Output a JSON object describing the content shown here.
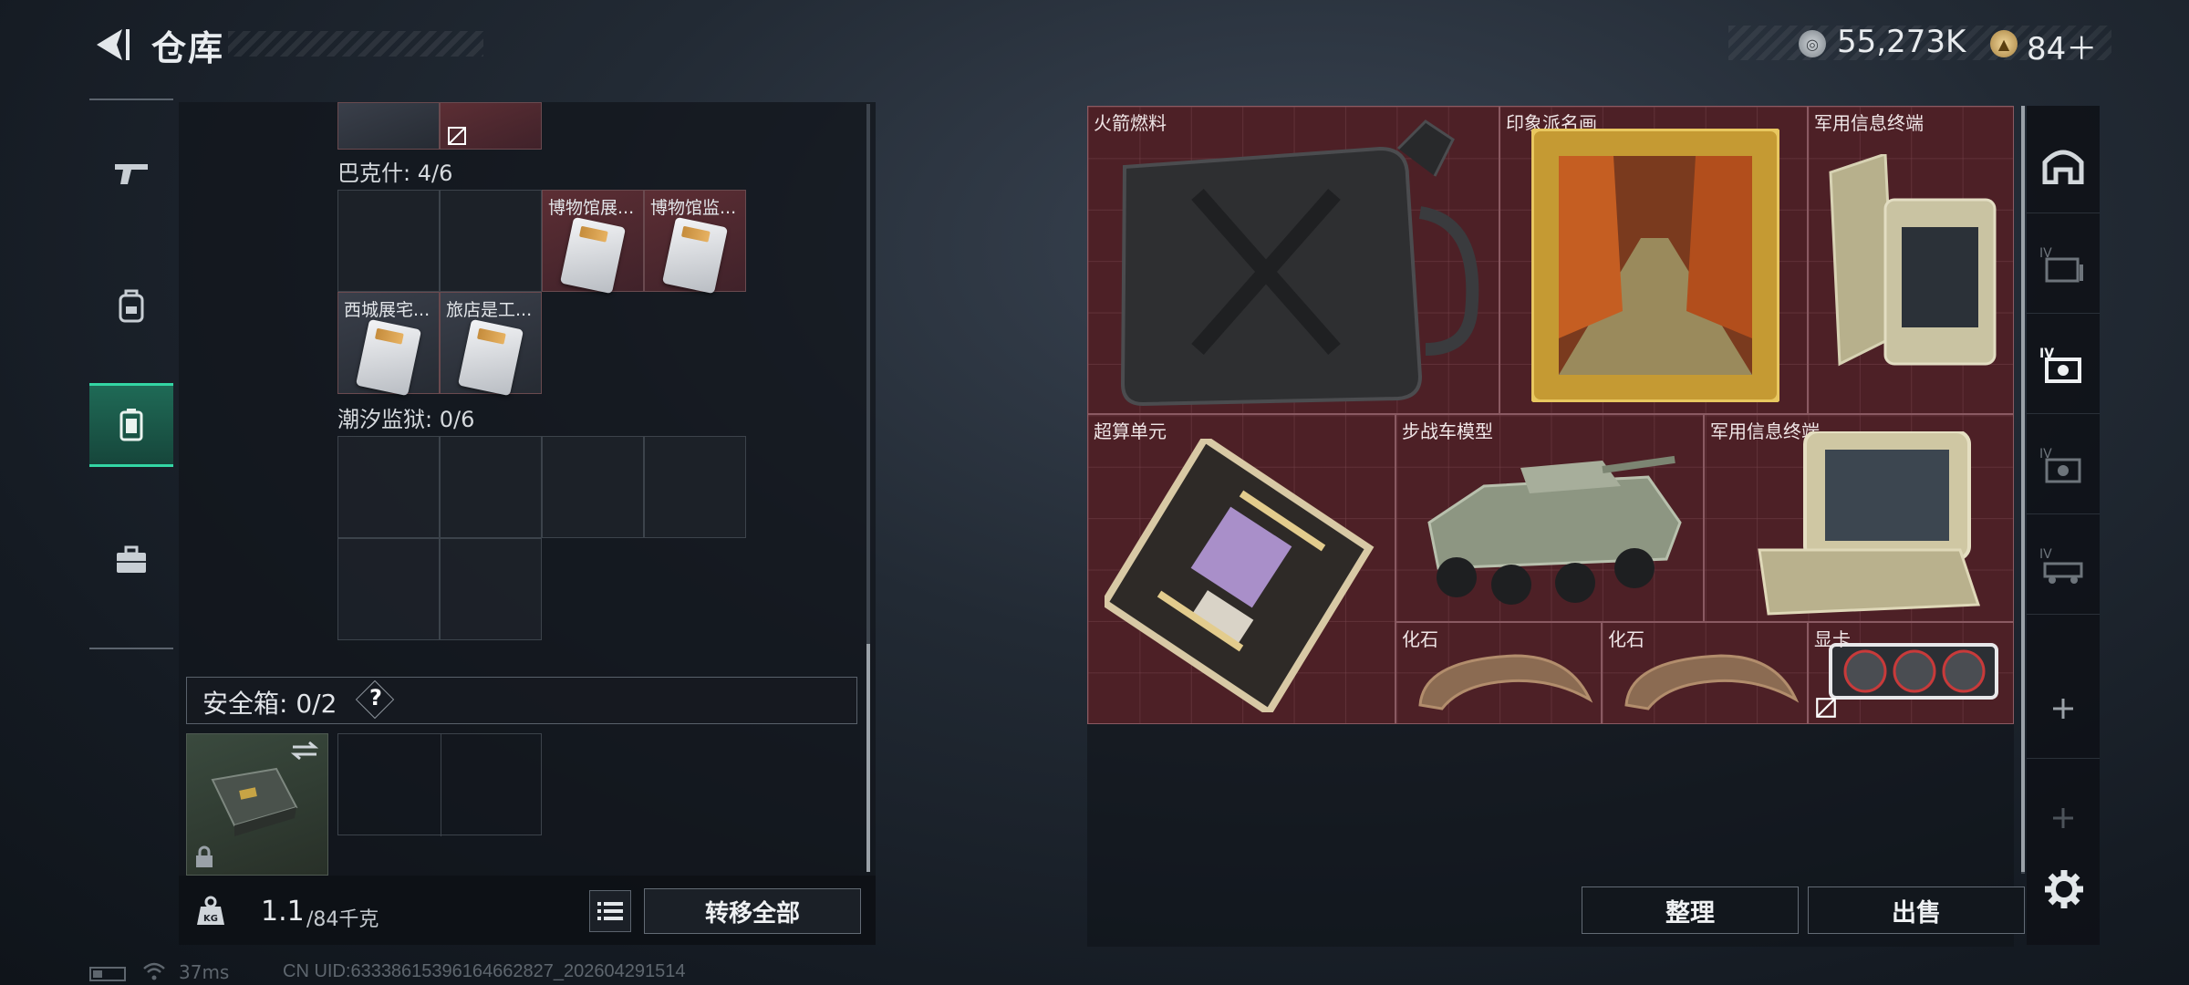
{
  "header": {
    "title": "仓库",
    "silver_amount": "55,273K",
    "gold_amount": "84＋"
  },
  "left_tabs": [
    {
      "icon": "gun-icon",
      "selected": false
    },
    {
      "icon": "backpack-icon",
      "selected": false
    },
    {
      "icon": "container-icon",
      "selected": true
    },
    {
      "icon": "briefcase-icon",
      "selected": false
    }
  ],
  "collections": [
    {
      "label": "巴克什: 4/6",
      "items": [
        "博物馆展...",
        "博物馆监...",
        "西城展宅...",
        "旅店是工..."
      ]
    },
    {
      "label": "潮汐监狱: 0/6"
    }
  ],
  "safe_box": {
    "label": "安全箱: 0/2",
    "help": "?"
  },
  "bottom_left": {
    "weight_value": "1.1",
    "weight_capacity": "/84千克",
    "transfer_all": "转移全部"
  },
  "stash_items": [
    {
      "label": "火箭燃料"
    },
    {
      "label": "印象派名画"
    },
    {
      "label": "军用信息终端"
    },
    {
      "label": "超算单元"
    },
    {
      "label": "步战车模型"
    },
    {
      "label": "军用信息终端"
    },
    {
      "label": "化石"
    },
    {
      "label": "化石"
    },
    {
      "label": "显卡"
    }
  ],
  "right_tabs": [
    "dome-icon",
    "tier-4-crate-icon",
    "tier-4-case-icon",
    "tier-4-box-icon",
    "tier-4-vehicle-icon",
    "add-icon",
    "add-icon"
  ],
  "buttons": {
    "sort": "整理",
    "sell": "出售"
  },
  "status_bar": {
    "ping": "37ms",
    "uid": "CN UID:6333861539616466282​7_202604291514"
  },
  "colors": {
    "accent": "#33d6a4",
    "stash_bg": "#4d2026"
  }
}
